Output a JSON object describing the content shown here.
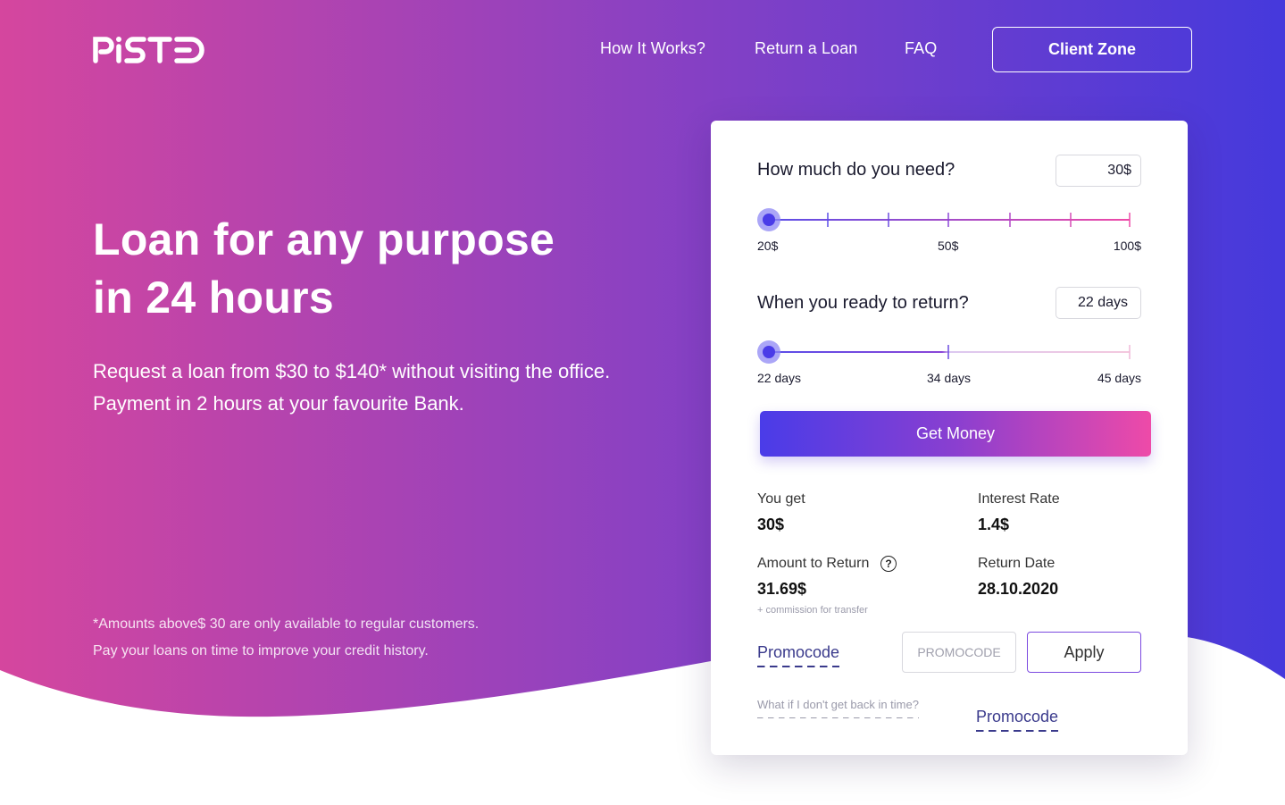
{
  "brand": {
    "logo_text": "PISTO"
  },
  "colors": {
    "gradient_start": "#d5469e",
    "gradient_mid": "#8b41c2",
    "gradient_end": "#4539dc",
    "slider_accent": "#5a4de8"
  },
  "nav": {
    "items": [
      {
        "label": "How It Works?"
      },
      {
        "label": "Return a Loan"
      },
      {
        "label": "FAQ"
      }
    ],
    "client_zone_label": "Client Zone"
  },
  "hero": {
    "headline_line1": "Loan for any purpose",
    "headline_line2": "in 24 hours",
    "subtitle_line1": "Request a loan from $30 to $140* without visiting the office.",
    "subtitle_line2": "Payment in 2 hours at your favourite Bank.",
    "note_line1": "*Amounts above$ 30 are only available to regular customers.",
    "note_line2": "Pay your loans on time to improve your credit history."
  },
  "calculator": {
    "amount": {
      "question": "How much do you need?",
      "value": "30$",
      "slider_position": 0,
      "tick_labels": [
        "20$",
        "50$",
        "100$"
      ]
    },
    "term": {
      "question": "When you ready to return?",
      "value": "22 days",
      "slider_position": 0,
      "tick_labels": [
        "22 days",
        "34 days",
        "45 days"
      ]
    },
    "get_money_label": "Get Money",
    "summary": {
      "you_get_label": "You get",
      "you_get_value": "30$",
      "interest_label": "Interest Rate",
      "interest_value": "1.4$",
      "amount_return_label": "Amount to Return",
      "amount_return_value": "31.69$",
      "return_date_label": "Return Date",
      "return_date_value": "28.10.2020",
      "commission_note": "+ commission for transfer"
    },
    "promo": {
      "link_label": "Promocode",
      "input_placeholder": "PROMOCODE",
      "apply_label": "Apply",
      "what_if_label": "What if I don't get back in time?",
      "second_link_label": "Promocode"
    }
  }
}
